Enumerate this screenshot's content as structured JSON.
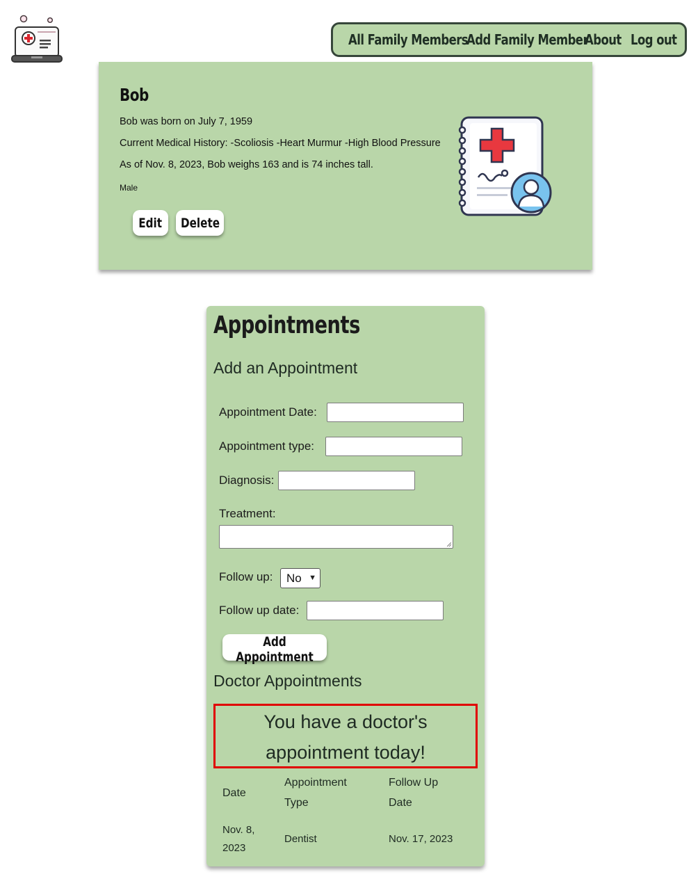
{
  "nav": {
    "items": [
      "All Family Members",
      "Add Family Member",
      "About",
      "Log out"
    ]
  },
  "profile": {
    "name": "Bob",
    "born": "Bob was born on July 7, 1959",
    "history": "Current Medical History: -Scoliosis -Heart Murmur -High Blood Pressure",
    "weight": "As of Nov. 8, 2023, Bob weighs 163 and is 74 inches tall.",
    "sex": "Male",
    "edit_label": "Edit",
    "delete_label": "Delete"
  },
  "appointments": {
    "title": "Appointments",
    "add_title": "Add an Appointment",
    "date_label": "Appointment Date:",
    "type_label": "Appointment type:",
    "diagnosis_label": "Diagnosis:",
    "treatment_label": "Treatment:",
    "follow_label": "Follow up:",
    "follow_value": "No",
    "follow_date_label": "Follow up date:",
    "add_button": "Add Appointment",
    "doctor_title": "Doctor Appointments",
    "alert_line1": "You have a doctor's",
    "alert_line2": "appointment today!",
    "table": {
      "headers": [
        [
          "Date"
        ],
        [
          "Appointment",
          "Type"
        ],
        [
          "Follow Up",
          "Date"
        ]
      ],
      "rows": [
        {
          "date": [
            "Nov. 8,",
            "2023"
          ],
          "type": "Dentist",
          "follow_up": "Nov. 17, 2023"
        }
      ]
    }
  },
  "colors": {
    "card": "#b9d6a9",
    "nav_border": "#36463a",
    "alert_border": "#e00000"
  }
}
